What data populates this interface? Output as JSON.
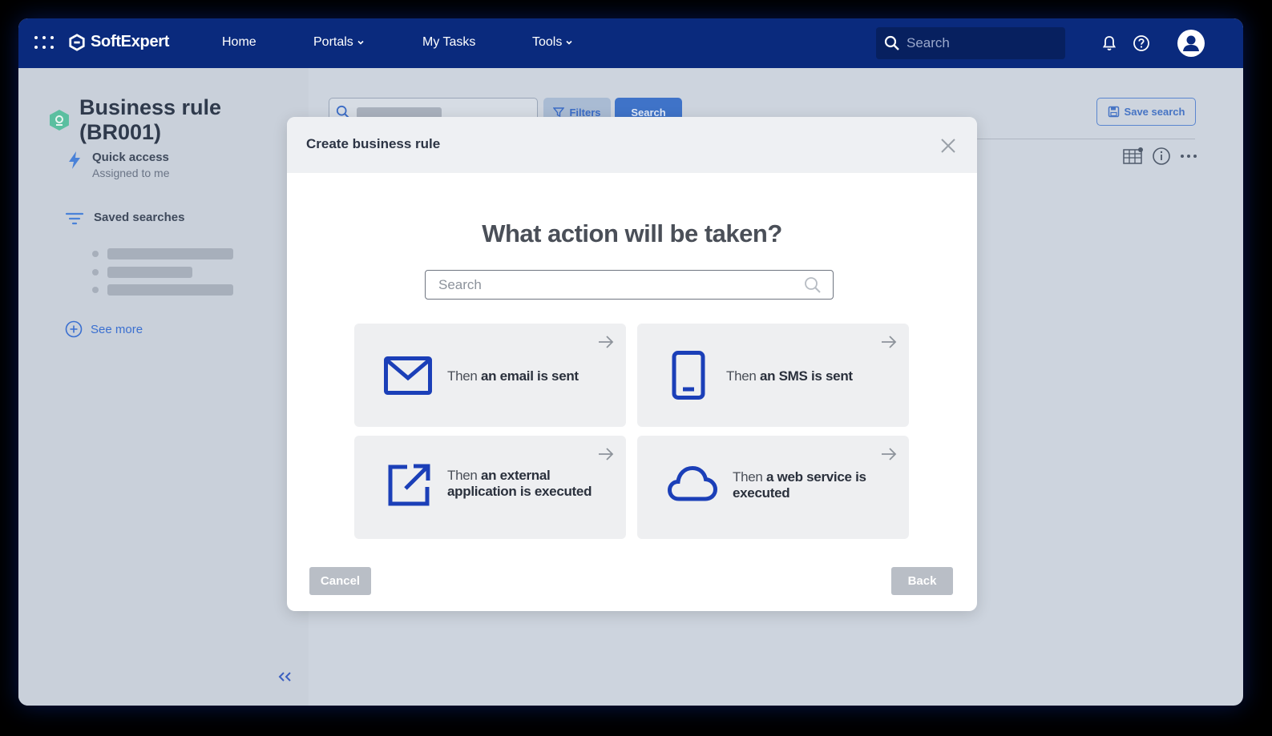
{
  "topbar": {
    "brand": "SoftExpert",
    "nav": [
      {
        "label": "Home"
      },
      {
        "label": "Portals"
      },
      {
        "label": "My Tasks"
      },
      {
        "label": "Tools"
      }
    ],
    "search_placeholder": "Search"
  },
  "sidebar": {
    "title": "Business rule (BR001)",
    "quick_access": {
      "label": "Quick access",
      "sub": "Assigned to me"
    },
    "saved_searches": {
      "label": "Saved searches"
    },
    "see_more": "See more"
  },
  "main": {
    "filters_label": "Filters",
    "search_label": "Search",
    "save_search_label": "Save search"
  },
  "modal": {
    "title": "Create business rule",
    "question": "What action will be taken?",
    "search_placeholder": "Search",
    "options": [
      {
        "prefix": "Then ",
        "bold": "an email is sent",
        "icon": "envelope-icon"
      },
      {
        "prefix": "Then ",
        "bold": "an SMS is sent",
        "icon": "mobile-phone-icon"
      },
      {
        "prefix": "Then ",
        "bold": "an external application is executed",
        "icon": "external-link-icon"
      },
      {
        "prefix": "Then ",
        "bold": "a web service is executed",
        "icon": "cloud-icon"
      }
    ],
    "cancel_label": "Cancel",
    "back_label": "Back"
  },
  "colors": {
    "topbar": "#0a2a7d",
    "accent": "#1b3fb8",
    "overlay": "#cdd4de"
  }
}
